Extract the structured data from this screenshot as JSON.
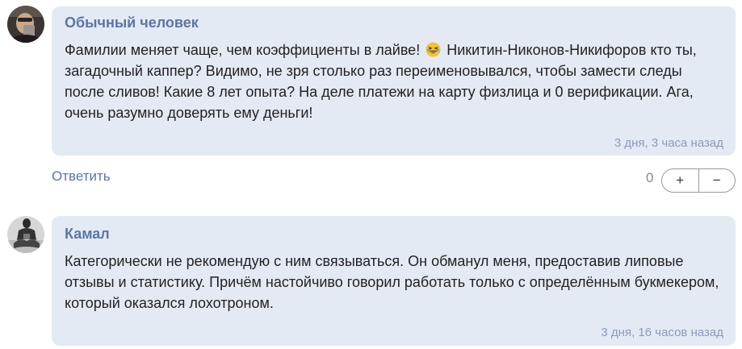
{
  "comments": [
    {
      "author": "Обычный человек",
      "text_before": "Фамилии меняет чаще, чем коэффициенты в лайве!",
      "emoji": "grinning-squinting-face",
      "text_after": "Никитин-Никонов-Никифоров кто ты, загадочный каппер? Видимо, не зря столько раз переименовывался, чтобы замести следы после сливов! Какие 8 лет опыта? На деле платежи на карту физлица и 0 верификации. Ага, очень разумно доверять ему деньги!",
      "timestamp": "3 дня, 3 часа назад",
      "reply_label": "Ответить",
      "vote_count": "0",
      "upvote_label": "+",
      "downvote_label": "−"
    },
    {
      "author": "Камал",
      "text": "Категорически не рекомендую с ним связываться. Он обманул меня, предоставив липовые отзывы и статистику. Причём настойчиво говорил работать только с определённым букмекером, который оказался лохотроном.",
      "timestamp": "3 дня, 16 часов назад"
    }
  ],
  "colors": {
    "bubble_bg": "#e4eaf4",
    "author": "#5b76a3",
    "timestamp": "#8a9bb8",
    "text": "#222222"
  }
}
